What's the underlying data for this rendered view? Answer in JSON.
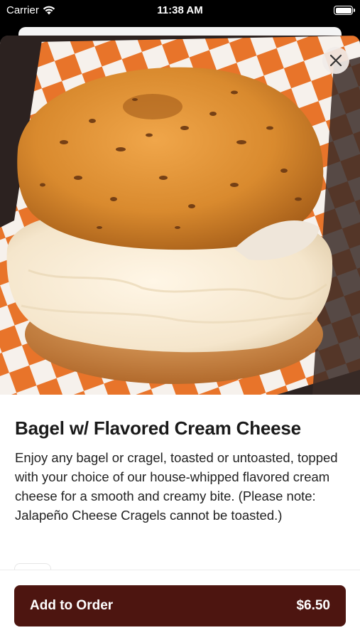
{
  "status_bar": {
    "carrier": "Carrier",
    "time": "11:38 AM",
    "wifi_icon": "wifi-icon",
    "battery_icon": "battery-icon"
  },
  "item": {
    "image_alt": "bagel-sandwich-photo",
    "title": "Bagel w/ Flavored Cream Cheese",
    "description": "Enjoy any bagel or cragel, toasted or untoasted, topped with your choice of our house-whipped flavored cream cheese for a smooth and creamy bite. (Please note: Jalapeño Cheese Cragels cannot be toasted.)"
  },
  "actions": {
    "close_icon": "close-icon",
    "add_label": "Add to Order",
    "price": "$6.50"
  },
  "colors": {
    "accent": "#4d1510",
    "checker_orange": "#e8742a"
  }
}
